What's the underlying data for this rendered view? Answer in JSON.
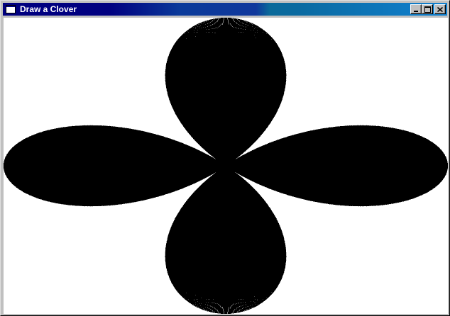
{
  "window": {
    "title": "Draw a Clover",
    "icon": "window-app-icon",
    "controls": [
      "minimize-icon",
      "maximize-icon",
      "close-icon"
    ]
  },
  "canvas": {
    "drawing": "clover-polar-line-fan",
    "stroke_color": "#000000",
    "background_color": "#ffffff"
  },
  "colors": {
    "title_bar_start": "#000080",
    "title_bar_end": "#1080d0",
    "chrome": "#c0c0c0"
  }
}
